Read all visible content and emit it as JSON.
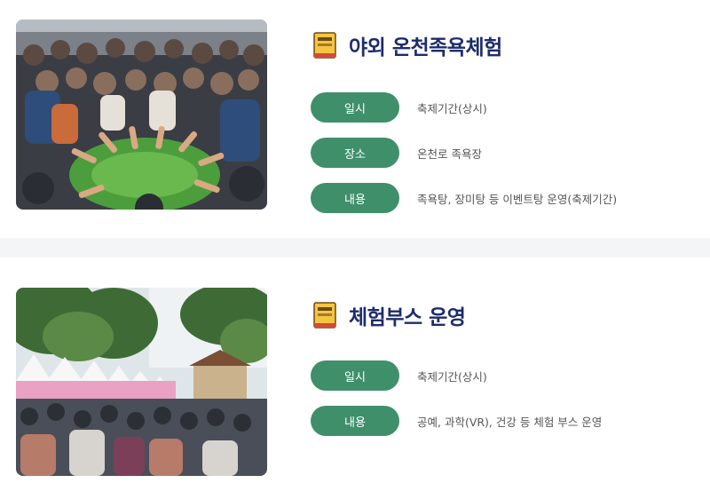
{
  "sections": [
    {
      "title": "야외 온천족욕체험",
      "rows": [
        {
          "label": "일시",
          "value": "축제기간(상시)"
        },
        {
          "label": "장소",
          "value": "온천로 족욕장"
        },
        {
          "label": "내용",
          "value": "족욕탕, 장미탕 등 이벤트탕 운영(축제기간)"
        }
      ]
    },
    {
      "title": "체험부스 운영",
      "rows": [
        {
          "label": "일시",
          "value": "축제기간(상시)"
        },
        {
          "label": "내용",
          "value": "공예, 과학(VR), 건강 등 체험 부스 운영"
        }
      ]
    }
  ],
  "colors": {
    "title": "#1e2c6b",
    "pill": "#3f8f6b",
    "divider": "#f4f5f7"
  },
  "icons": [
    "book-icon",
    "book-icon"
  ]
}
